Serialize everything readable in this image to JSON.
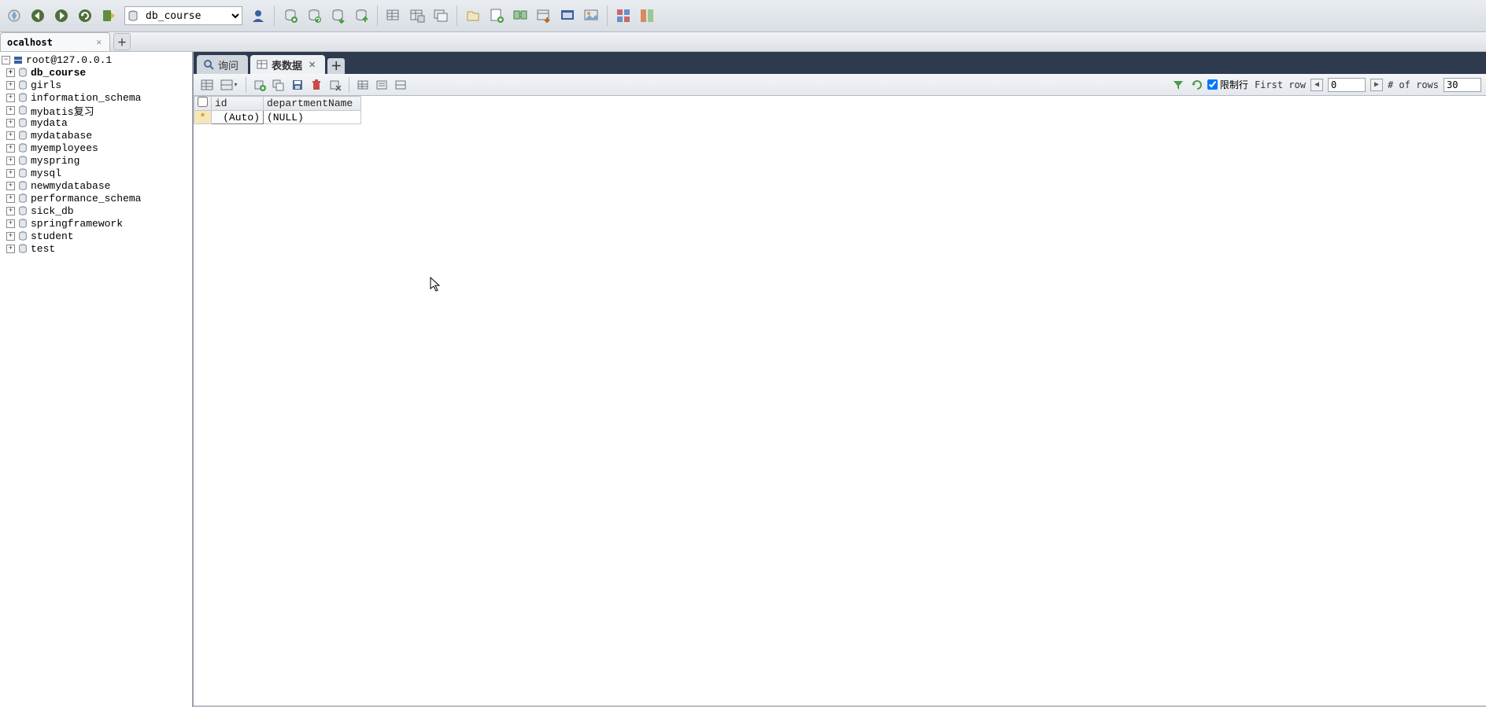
{
  "toolbar": {
    "database_selected": "db_course"
  },
  "connection_tabs": {
    "active": {
      "label": "ocalhost"
    }
  },
  "sidebar": {
    "root_label": "root@127.0.0.1",
    "databases": [
      {
        "name": "db_course",
        "bold": true
      },
      {
        "name": "girls",
        "bold": false
      },
      {
        "name": "information_schema",
        "bold": false
      },
      {
        "name": "mybatis复习",
        "bold": false
      },
      {
        "name": "mydata",
        "bold": false
      },
      {
        "name": "mydatabase",
        "bold": false
      },
      {
        "name": "myemployees",
        "bold": false
      },
      {
        "name": "myspring",
        "bold": false
      },
      {
        "name": "mysql",
        "bold": false
      },
      {
        "name": "newmydatabase",
        "bold": false
      },
      {
        "name": "performance_schema",
        "bold": false
      },
      {
        "name": "sick_db",
        "bold": false
      },
      {
        "name": "springframework",
        "bold": false
      },
      {
        "name": "student",
        "bold": false
      },
      {
        "name": "test",
        "bold": false
      }
    ]
  },
  "inner_tabs": {
    "query_label": "询问",
    "tabledata_label": "表数据"
  },
  "pager": {
    "limit_label": "限制行",
    "first_row_label": "First row",
    "first_row_value": "0",
    "num_rows_label": "# of rows",
    "num_rows_value": "30"
  },
  "grid": {
    "columns": [
      "id",
      "departmentName"
    ],
    "rows": [
      {
        "marker": "*",
        "id": "(Auto)",
        "departmentName": "(NULL)"
      }
    ]
  }
}
